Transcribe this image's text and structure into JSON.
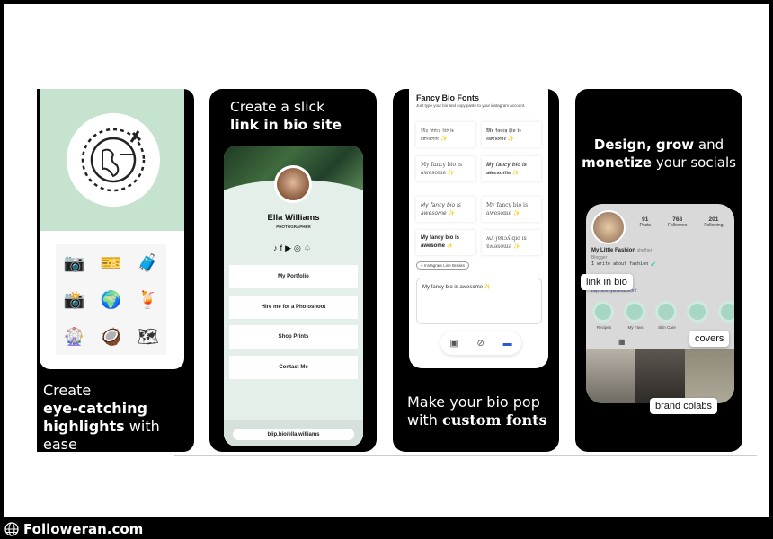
{
  "panel1": {
    "caption": [
      "Create",
      "eye-catching",
      "highlights",
      "with ease"
    ],
    "colors": {
      "green": "#c5e3cf"
    },
    "icons": [
      "camera",
      "ticket",
      "suitcase",
      "instant-camera",
      "globe",
      "drink",
      "ferris-wheel",
      "coconut",
      "map"
    ]
  },
  "panel2": {
    "title_line1": "Create a slick",
    "title_line2": "link in bio site",
    "name": "Ella Williams",
    "role": "PHOTOGRAPHER",
    "social_icons": [
      "tiktok",
      "facebook",
      "youtube",
      "instagram",
      "snapchat"
    ],
    "buttons": [
      "My Portfolio",
      "Hire me for a Photoshoot",
      "Shop Prints",
      "Contact Me"
    ],
    "url": "blip.bio/ella.williams"
  },
  "panel3": {
    "app_title": "Fancy Bio Fonts",
    "subtitle": "Just type your bio and copy paste to your instagram account.",
    "samples": [
      "𝔐𝔶 𝔣𝔞𝔫𝔠𝔶 𝔟𝔦𝔬 𝔦𝔰 𝔞𝔴𝔢𝔰𝔬𝔪𝔢 ✨",
      "𝕸𝖞 𝖋𝖆𝖓𝖈𝖞 𝖇𝖎𝖔 𝖎𝖘 𝖆𝖜𝖊𝖘𝖔𝖒𝖊 ✨",
      "My fancy bio is awesome ✨",
      "𝑴𝒚 𝒇𝒂𝒏𝒄𝒚 𝒃𝒊𝒐 𝒊𝒔 𝒂𝒘𝒆𝒔𝒐𝒎𝒆 ✨",
      "𝘔𝘺 𝘧𝘢𝘯𝘤𝘺 𝘣𝘪𝘰 𝘪𝘴 𝘢𝘸𝘦𝘴𝘰𝘮𝘦 ✨",
      "My fancy bio is awesome ✨",
      "My fancy bio is awesome ✨",
      "ʍʎ ɟɐuɔʎ qıo ıs ɐʍǝsoɯǝ ✨"
    ],
    "toggle_label": "Instagram Line Breaks",
    "input_value": "My fancy bio is awesome ✨",
    "caption_line1": "Make your bio pop",
    "caption_line2_pre": "with ",
    "caption_line2_bold": "custom fonts"
  },
  "panel4": {
    "title_line1_bold": "Design, grow",
    "title_line1_rest": " and",
    "title_line2_bold": "monetize",
    "title_line2_rest": " your socials",
    "posts": "91",
    "posts_label": "Posts",
    "followers": "768",
    "followers_label": "Followers",
    "following": "201",
    "following_label": "Following",
    "profile_name": "My Little Fashion",
    "pronouns": "she/her",
    "category": "Blogger",
    "bio": "I write about fashion 🧪",
    "link": "blip.bio/mylittlefashion/",
    "highlights": [
      "Recipes",
      "My Favs",
      "Skin Care",
      "",
      ""
    ],
    "tags": {
      "link": "link in bio",
      "covers": "covers",
      "collabs": "brand colabs"
    }
  },
  "footer": {
    "brand": "Followeran.com"
  }
}
